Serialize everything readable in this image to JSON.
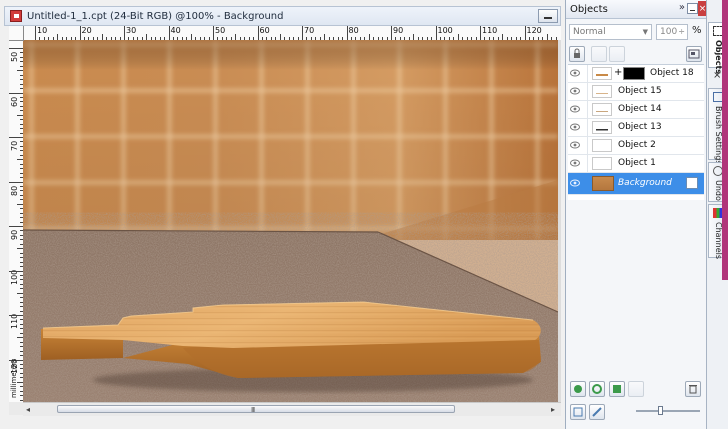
{
  "document": {
    "title": "Untitled-1_1.cpt (24-Bit RGB) @100% - Background",
    "ruler_top_labels": [
      "10",
      "20",
      "30",
      "40",
      "50",
      "60",
      "70",
      "80",
      "90",
      "100",
      "110",
      "120"
    ],
    "ruler_left_labels": [
      "50",
      "60",
      "70",
      "80",
      "90",
      "100",
      "110",
      "120"
    ],
    "ruler_units": "millimeters",
    "scroll_grip": "III",
    "scroll_left_arrow": "◂",
    "scroll_right_arrow": "▸"
  },
  "docker": {
    "title": "Objects",
    "expand_glyph": "»",
    "close_glyph": "×",
    "blend_mode": "Normal",
    "opacity_value": "100",
    "opacity_unit": "%",
    "layers": [
      {
        "label": "Object 18",
        "selected": false
      },
      {
        "label": "Object 15",
        "selected": false
      },
      {
        "label": "Object 14",
        "selected": false
      },
      {
        "label": "Object 13",
        "selected": false
      },
      {
        "label": "Object 2",
        "selected": false
      },
      {
        "label": "Object 1",
        "selected": false
      },
      {
        "label": "Background",
        "selected": true
      }
    ]
  },
  "side_tabs": {
    "close_glyph": "×",
    "tabs": [
      {
        "label": "Objects"
      },
      {
        "label": "Brush Settings"
      },
      {
        "label": "Undo"
      },
      {
        "label": "Channels"
      }
    ]
  },
  "colors": {
    "selection": "#3d8ee8",
    "close_red": "#c94040",
    "accent_pink": "#b0357a"
  }
}
